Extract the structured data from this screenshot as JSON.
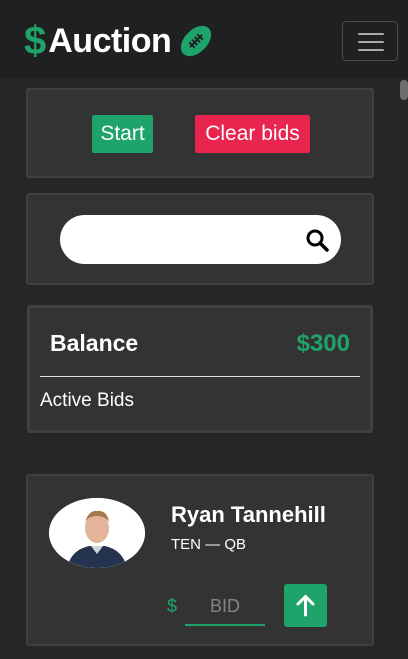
{
  "brand": {
    "dollar": "$",
    "name": "Auction",
    "logo_icon": "football-icon"
  },
  "nav": {
    "menu_icon": "hamburger-menu-icon"
  },
  "controls": {
    "start_label": "Start",
    "clear_label": "Clear bids"
  },
  "search": {
    "placeholder": "",
    "icon": "search-icon"
  },
  "balance": {
    "label": "Balance",
    "value": "$300",
    "active_bids_label": "Active Bids"
  },
  "player": {
    "name": "Ryan Tannehill",
    "meta": "TEN — QB",
    "bid_currency": "$",
    "bid_placeholder": "BID",
    "bid_button_icon": "arrow-up-icon"
  },
  "colors": {
    "accent": "#1ea36a",
    "danger": "#e8244f",
    "background": "#262626",
    "card": "#333333"
  }
}
